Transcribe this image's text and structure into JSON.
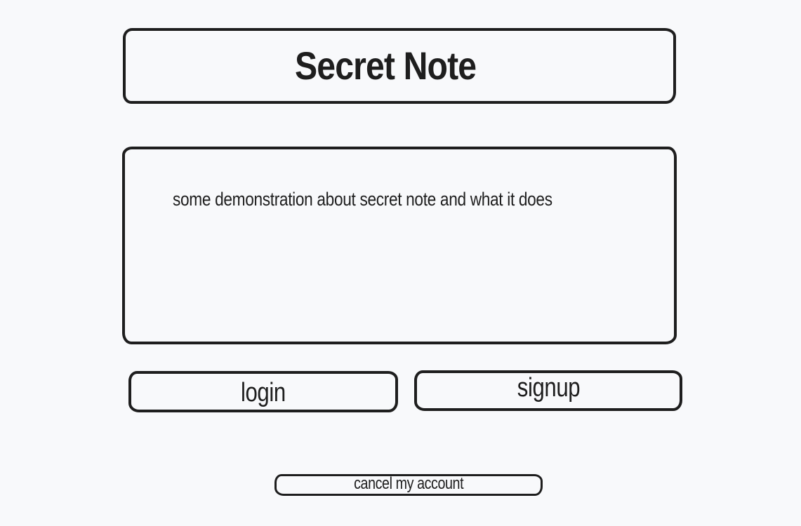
{
  "header": {
    "title": "Secret Note"
  },
  "description": {
    "text": "some demonstration about secret note and what it does"
  },
  "actions": {
    "login_label": "login",
    "signup_label": "signup",
    "cancel_label": "cancel my account"
  },
  "colors": {
    "background": "#f8f9fb",
    "stroke": "#1e1e1e"
  }
}
